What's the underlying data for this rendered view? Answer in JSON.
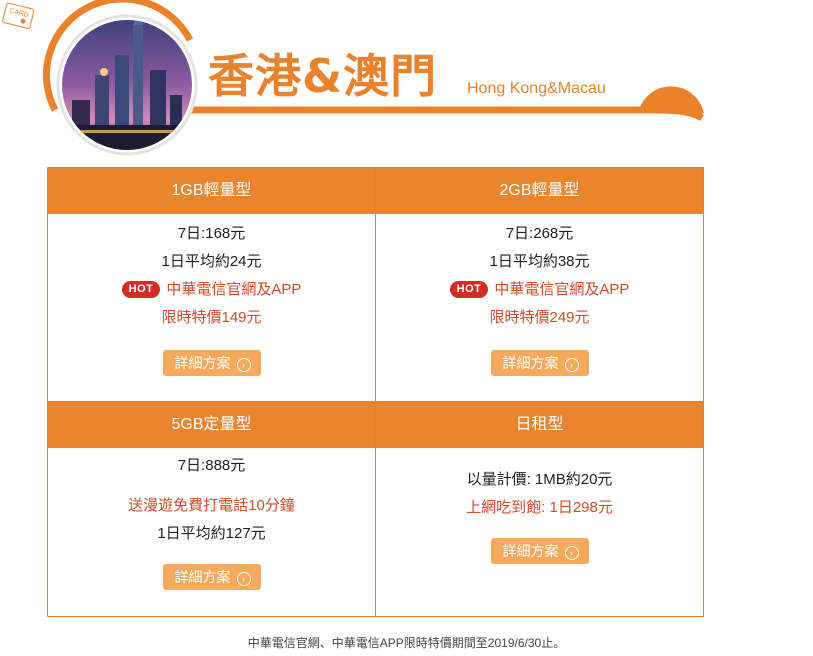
{
  "header": {
    "title": "香港&澳門",
    "subtitle": "Hong Kong&Macau",
    "card_label": "CARD"
  },
  "plans": [
    {
      "name": "1GB輕量型",
      "price": "7日:168元",
      "daily": "1日平均約24元",
      "hot_badge": "HOT",
      "channel": "中華電信官網及APP",
      "promo": "限時特價149元",
      "button": "詳細方案"
    },
    {
      "name": "2GB輕量型",
      "price": "7日:268元",
      "daily": "1日平均約38元",
      "hot_badge": "HOT",
      "channel": "中華電信官網及APP",
      "promo": "限時特價249元",
      "button": "詳細方案"
    },
    {
      "name": "5GB定量型",
      "price": "7日:888元",
      "bonus": "送漫遊免費打電話10分鐘",
      "daily": "1日平均約127元",
      "button": "詳細方案"
    },
    {
      "name": "日租型",
      "metered": "以量計價: 1MB約20元",
      "unlimited": "上網吃到飽: 1日298元",
      "button": "詳細方案"
    }
  ],
  "footer": {
    "note": "中華電信官網、中華電信APP限時特價期間至2019/6/30止。"
  },
  "colors": {
    "accent": "#e9852e",
    "button": "#f5a95c",
    "hot": "#d62b22",
    "promo_text": "#d14a2b"
  }
}
